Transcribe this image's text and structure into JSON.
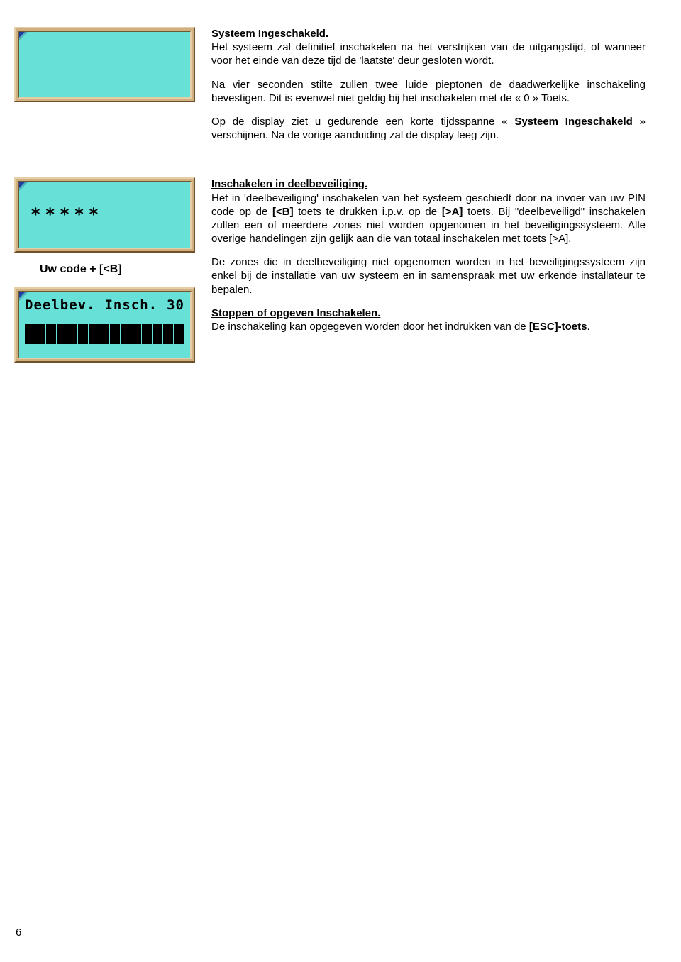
{
  "section1": {
    "heading": "Systeem Ingeschakeld.",
    "para_parts": {
      "p1": "Het systeem zal definitief inschakelen na het verstrijken van de uitgangstijd, of wanneer voor het einde van deze tijd de 'laatste' deur gesloten wordt.",
      "p2": "Na vier seconden stilte zullen twee luide pieptonen de daadwerkelijke inschakeling bevestigen. Dit is evenwel niet geldig bij het inschakelen met de « 0 » Toets.",
      "p3a": "Op de display ziet u gedurende een korte tijdsspanne « ",
      "p3b": "Systeem Ingeschakeld",
      "p3c": " » verschijnen. Na de vorige aanduiding zal de display leeg zijn."
    }
  },
  "section2": {
    "display2_text": "*****",
    "caption": "Uw code + [<B]",
    "display3": {
      "label1": "Deelbev.",
      "label2": "Insch.",
      "count": "30"
    },
    "heading_a": "Inschakelen in deelbeveiliging.",
    "para_a_parts": {
      "t1": "Het in 'deelbeveiliging' inschakelen van het systeem geschiedt door na invoer van uw PIN code op de ",
      "k1": "[<B]",
      "t2": " toets te drukken i.p.v. op de ",
      "k2": "[>A]",
      "t3": " toets. Bij \"deelbeveiligd\" inschakelen zullen een of meerdere zones niet worden opgenomen in het beveiligingssysteem. Alle overige handelingen zijn gelijk aan die van totaal inschakelen met toets [>A]."
    },
    "para_b": "De zones die in deelbeveiliging niet opgenomen worden in het beveiligingssysteem zijn enkel bij de installatie van uw systeem en in samenspraak met uw erkende installateur te bepalen.",
    "heading_c": "Stoppen of opgeven Inschakelen.",
    "para_c_parts": {
      "t1": "De inschakeling kan opgegeven worden door het indrukken van de ",
      "k1": "[ESC]-toets",
      "t2": "."
    }
  },
  "page_number": "6"
}
